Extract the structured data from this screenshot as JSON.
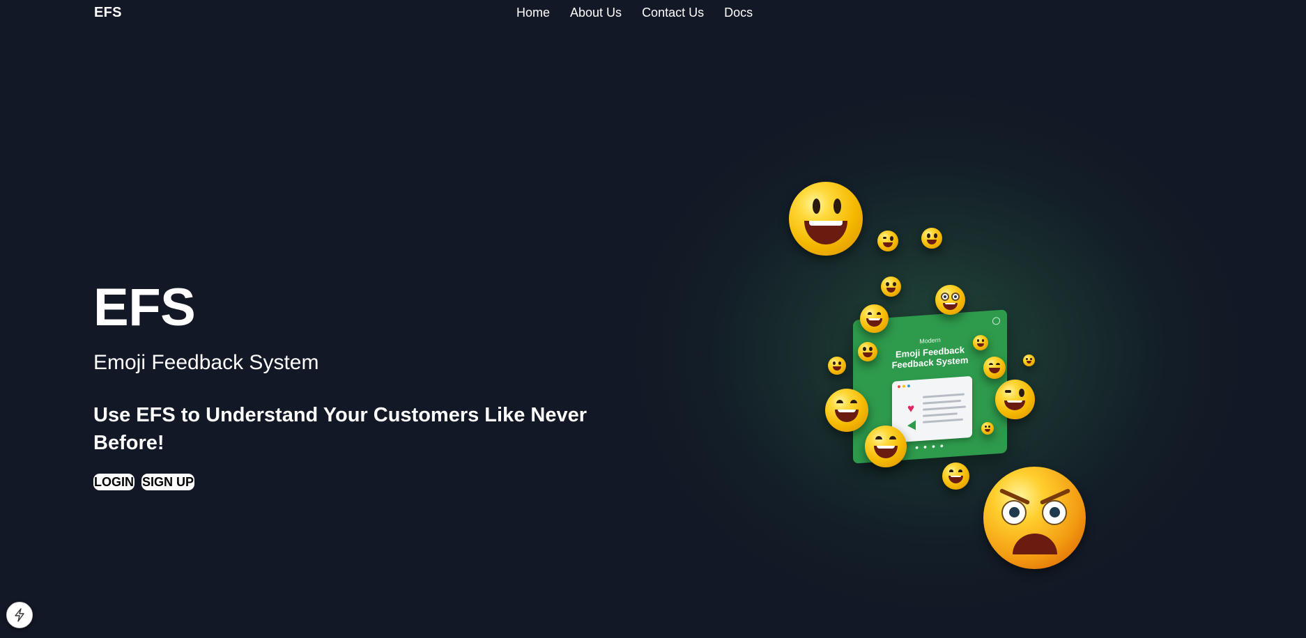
{
  "header": {
    "logo": "EFS",
    "nav": [
      "Home",
      "About Us",
      "Contact Us",
      "Docs"
    ]
  },
  "hero": {
    "title": "EFS",
    "subtitle": "Emoji Feedback System",
    "pitch": "Use EFS to Understand Your Customers Like Never Before!",
    "buttons": {
      "login": "LOGIN",
      "signup": "SIGN UP"
    }
  },
  "illustration": {
    "card_small": "Modern",
    "card_line1": "Emoji Feedback",
    "card_line2": "Feedback System"
  },
  "floating_button": {
    "icon": "lightning-icon"
  },
  "colors": {
    "background": "#121826",
    "text": "#ffffff",
    "card_green": "#2e9b4c",
    "emoji_yellow": "#ffd93b",
    "button_bg": "#ffffff"
  }
}
